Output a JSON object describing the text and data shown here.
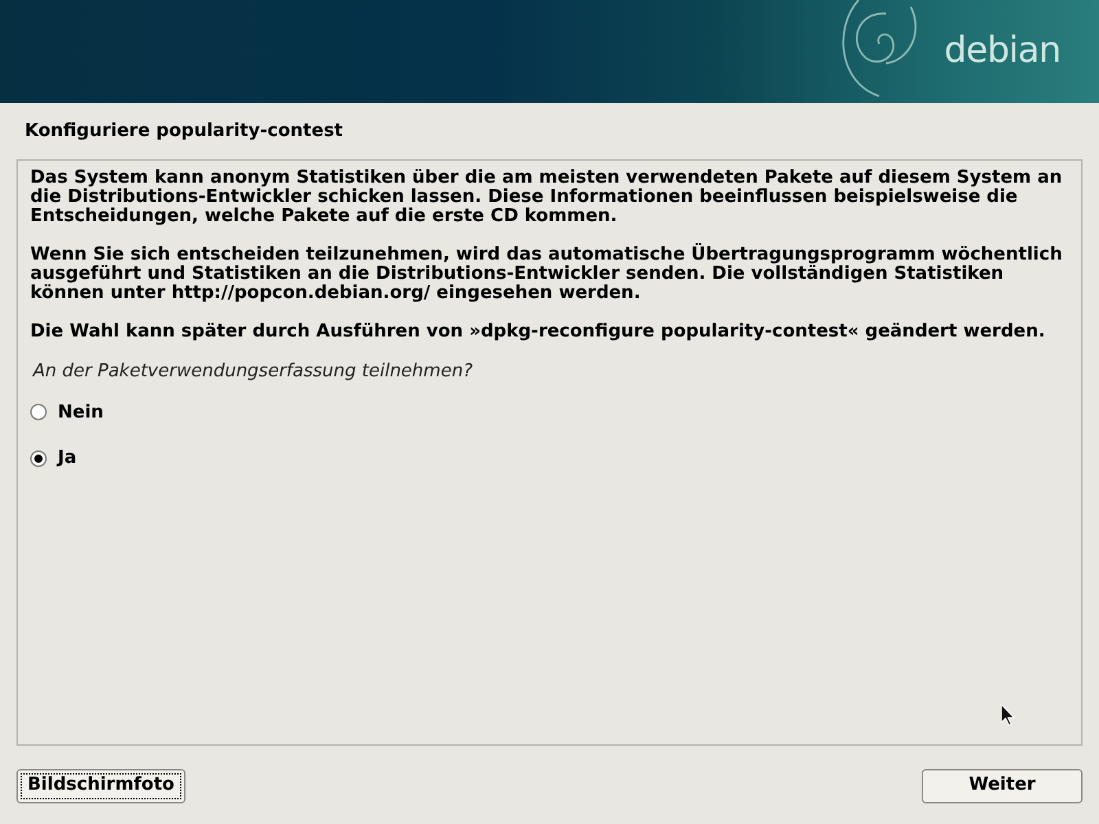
{
  "banner": {
    "logo_text": "debian"
  },
  "title": "Konfiguriere popularity-contest",
  "paragraphs": [
    "Das System kann anonym Statistiken über die am meisten verwendeten Pakete auf diesem System an die Distributions-Entwickler schicken lassen. Diese Informationen beeinflussen beispielsweise die Entscheidungen, welche Pakete auf die erste CD kommen.",
    "Wenn Sie sich entscheiden teilzunehmen, wird das automatische Übertragungsprogramm wöchentlich ausgeführt und Statistiken an die Distributions-Entwickler senden. Die vollständigen Statistiken können unter http://popcon.debian.org/ eingesehen werden.",
    "Die Wahl kann später durch Ausführen von »dpkg-reconfigure popularity-contest« geändert werden."
  ],
  "question": "An der Paketverwendungserfassung teilnehmen?",
  "options": [
    {
      "label": "Nein",
      "selected": false
    },
    {
      "label": "Ja",
      "selected": true
    }
  ],
  "buttons": {
    "left": "Bildschirmfoto",
    "right": "Weiter"
  }
}
